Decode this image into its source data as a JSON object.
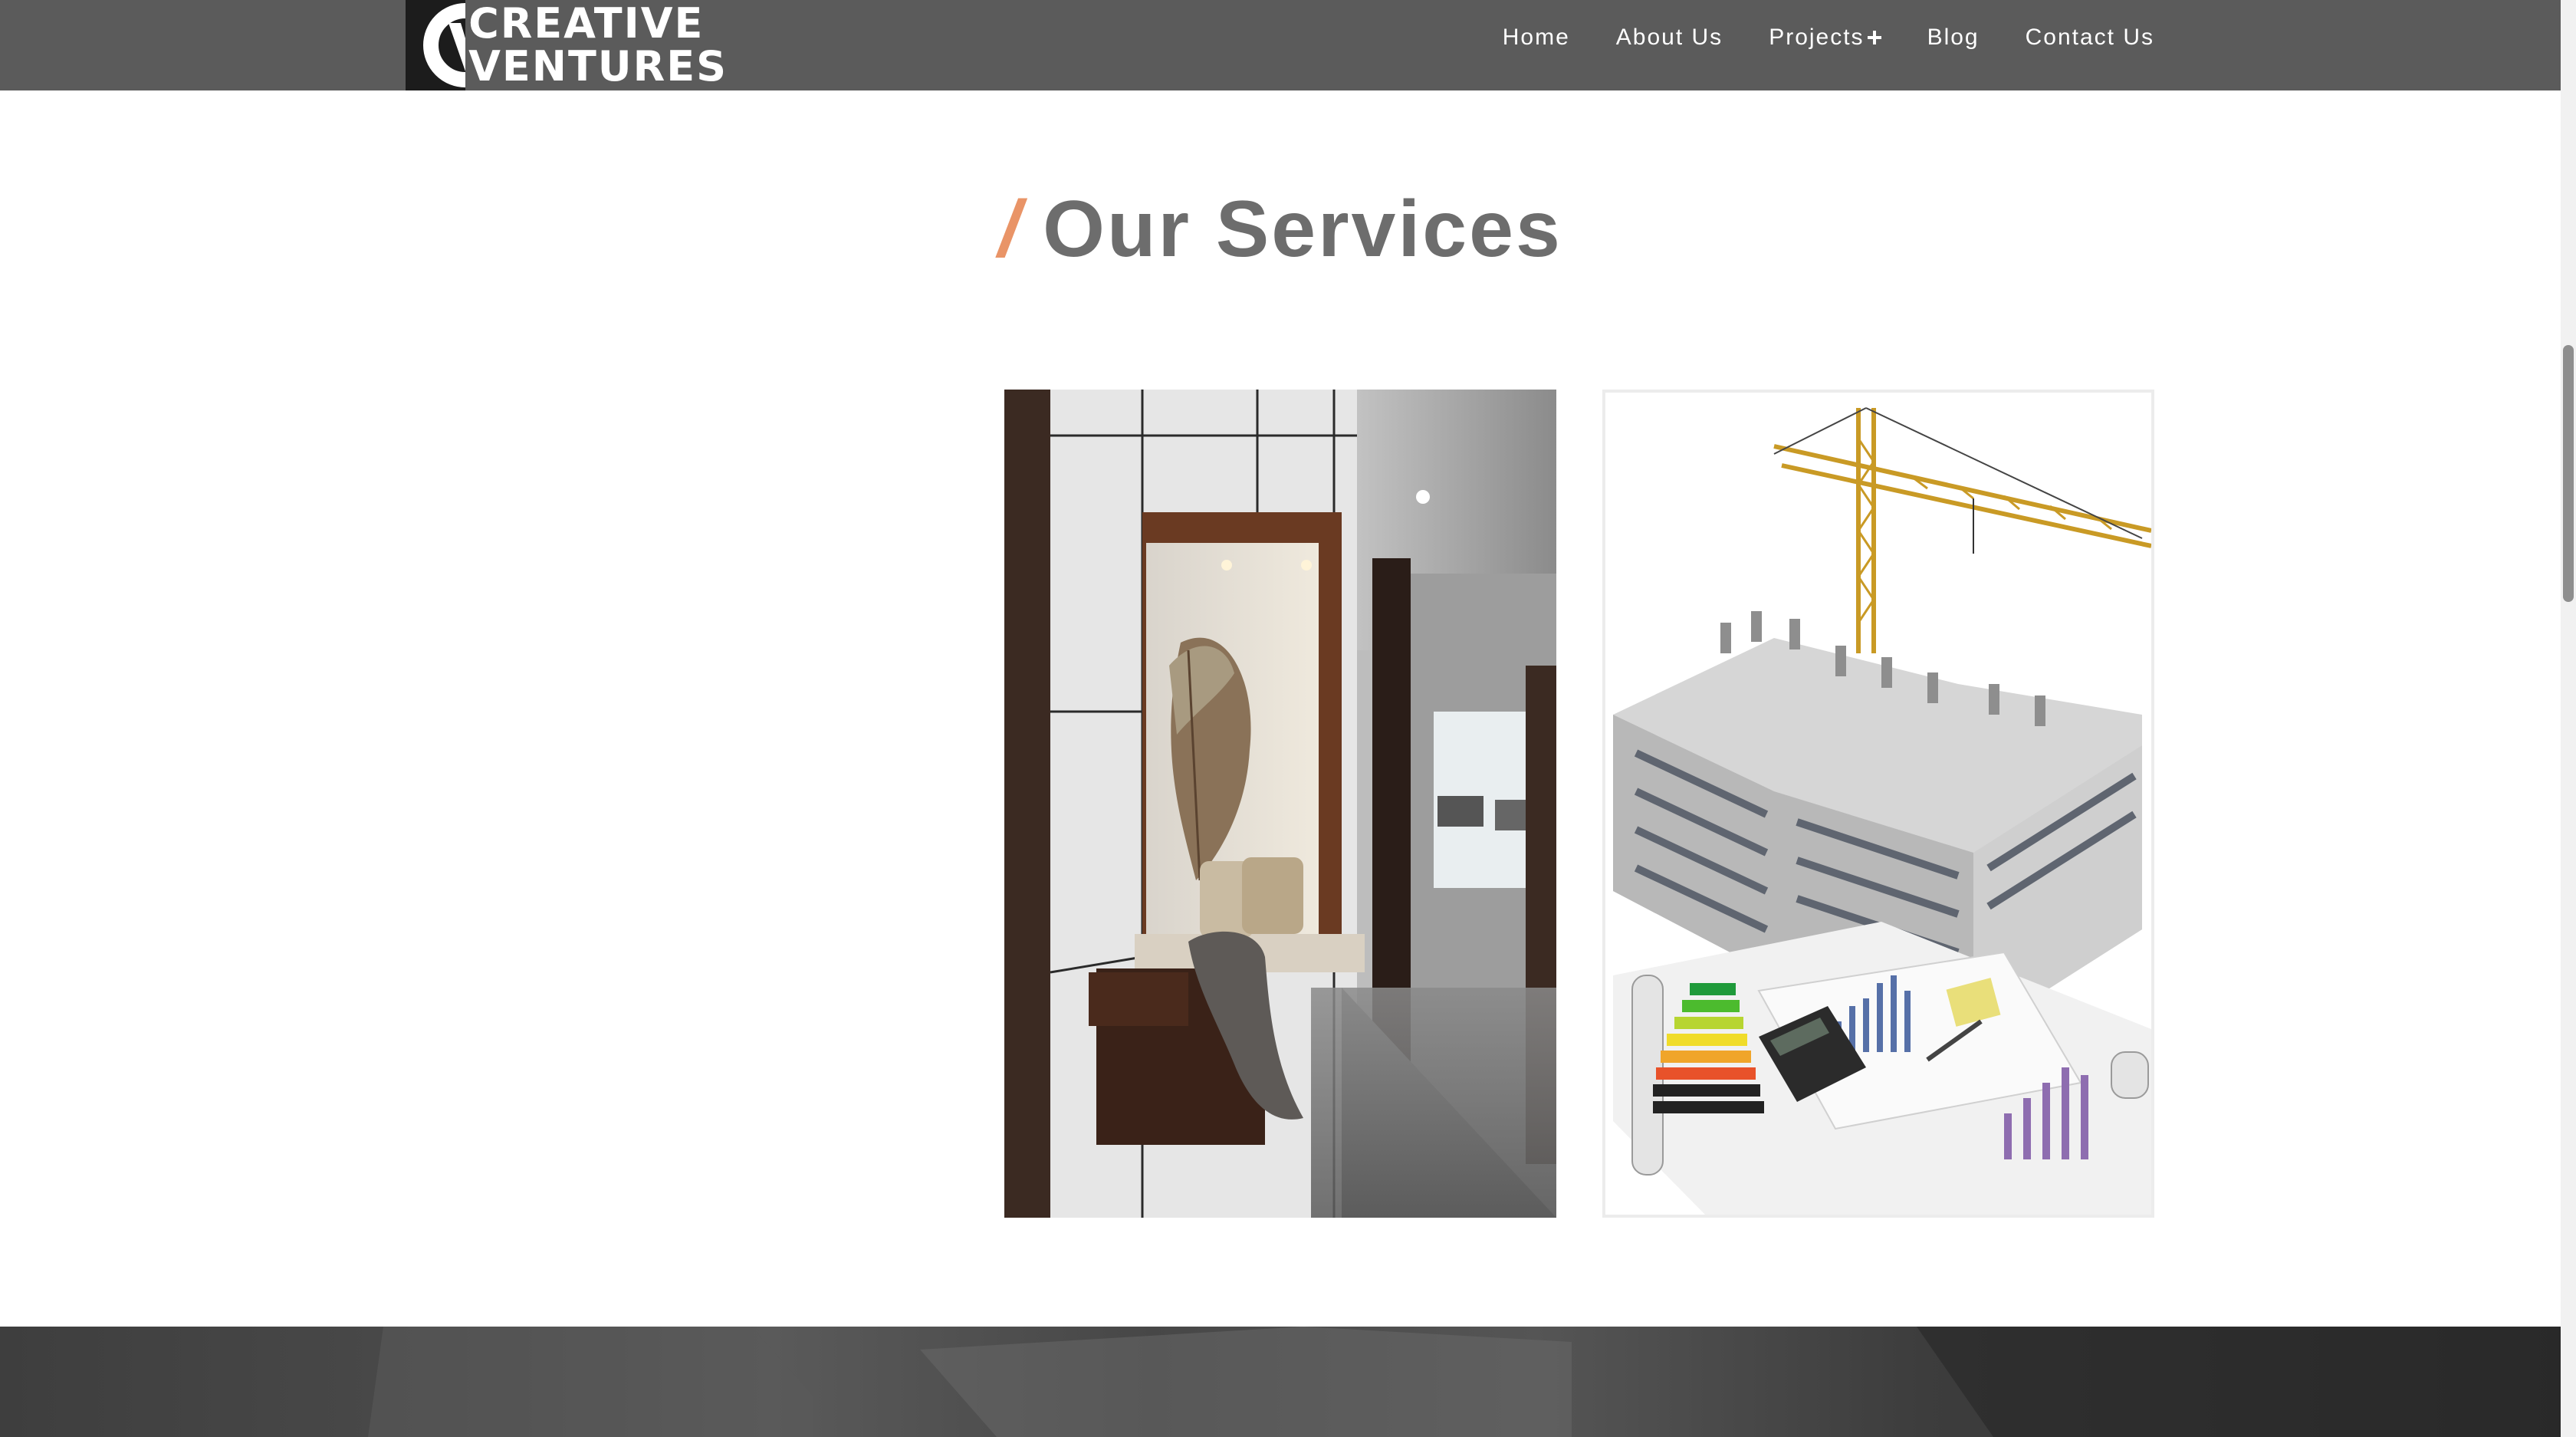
{
  "logo": {
    "mark": "CV",
    "line1": "CREATIVE",
    "line2": "VENTURES"
  },
  "nav": {
    "items": [
      {
        "label": "Home"
      },
      {
        "label": "About Us"
      },
      {
        "label": "Projects",
        "icon": "plus-icon"
      },
      {
        "label": "Blog"
      },
      {
        "label": "Contact Us"
      }
    ]
  },
  "services": {
    "title_prefix": "/",
    "title": "Our Services",
    "cards": [
      {
        "image": "interior-hallway-bench-image"
      },
      {
        "image": "building-construction-crane-plans-image"
      }
    ]
  },
  "colors": {
    "header_bg": "#5b5b5b",
    "accent": "#e99467",
    "title_text": "#6d6d6d",
    "band_bg": "#3e3e3e"
  }
}
